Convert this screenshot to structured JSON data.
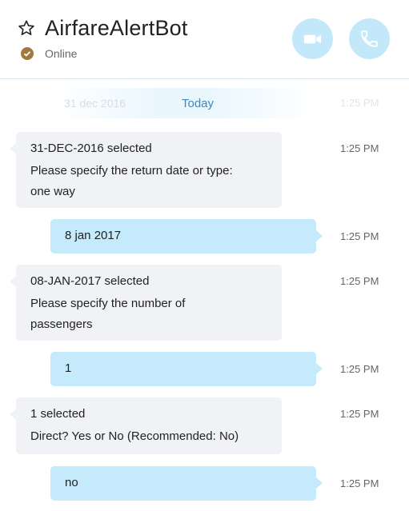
{
  "header": {
    "title": "AirfareAlertBot",
    "status": "Online",
    "icons": {
      "favorite": "star-icon",
      "video": "video-icon",
      "call": "phone-icon",
      "status": "check-icon"
    },
    "colors": {
      "accent": "#c2e8fa",
      "status": "#a07a3c",
      "link": "#3d87c4"
    }
  },
  "conversation": {
    "divider": {
      "ghost_text": "31 dec 2016",
      "label": "Today",
      "ghost_time": "1:25 PM"
    },
    "messages": [
      {
        "direction": "in",
        "lines": [
          "31-DEC-2016 selected",
          "Please specify the return date or type:",
          "one way"
        ],
        "time": "1:25 PM"
      },
      {
        "direction": "out",
        "lines": [
          "8 jan 2017"
        ],
        "time": "1:25 PM"
      },
      {
        "direction": "in",
        "lines": [
          "08-JAN-2017 selected",
          "Please specify the number of",
          "passengers"
        ],
        "time": "1:25 PM"
      },
      {
        "direction": "out",
        "lines": [
          "1"
        ],
        "time": "1:25 PM"
      },
      {
        "direction": "in",
        "lines": [
          "1 selected",
          "Direct? Yes or No (Recommended: No)"
        ],
        "time": "1:25 PM"
      },
      {
        "direction": "out",
        "lines": [
          "no"
        ],
        "time": "1:25 PM"
      }
    ]
  }
}
